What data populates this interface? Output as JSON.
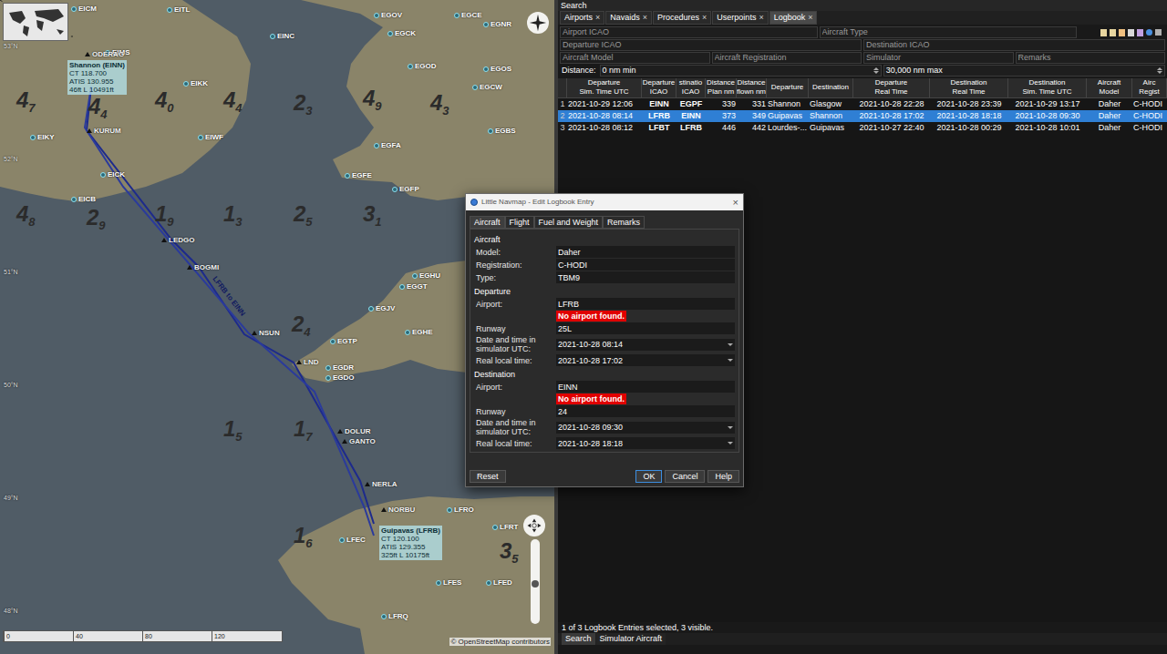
{
  "map": {
    "airports": [
      "EICM",
      "EITL",
      "EGOV",
      "EGCE",
      "EGNR",
      "EINC",
      "EGCK",
      "EGOD",
      "EGOS",
      "EIMS",
      "EIKK",
      "EGCW",
      "EIWF",
      "EIKY",
      "EICK",
      "EICB",
      "EGFA",
      "EGBS",
      "EGFE",
      "EGFP",
      "EGHU",
      "EGGT",
      "EGJV",
      "EGHE",
      "EGTP",
      "EGDR",
      "EGDO",
      "LFRO",
      "LFRT",
      "LFEC",
      "LFES",
      "LFED",
      "LFRQ"
    ],
    "waypoints": [
      "ODERAG",
      "KURUM",
      "LEDGO",
      "BOGMI",
      "NSUN",
      "LND",
      "DOLUR",
      "GANTO",
      "NERLA",
      "NORBU"
    ],
    "airport_boxes": [
      {
        "lines": [
          "Shannon (EINN)",
          "CT 118.700",
          "ATIS 130.955",
          "46ft L 10491ft"
        ]
      },
      {
        "lines": [
          "Guipavas (LFRB)",
          "CT 120.100",
          "ATIS 129.355",
          "325ft L 10175ft"
        ]
      }
    ],
    "grid": [
      {
        "big": "4",
        "small": "7"
      },
      {
        "big": "4",
        "small": "4"
      },
      {
        "big": "4",
        "small": "0"
      },
      {
        "big": "4",
        "small": "4"
      },
      {
        "big": "2",
        "small": "3"
      },
      {
        "big": "4",
        "small": "9"
      },
      {
        "big": "4",
        "small": "3"
      },
      {
        "big": "4",
        "small": "8"
      },
      {
        "big": "2",
        "small": "9"
      },
      {
        "big": "1",
        "small": "9"
      },
      {
        "big": "1",
        "small": "3"
      },
      {
        "big": "2",
        "small": "5"
      },
      {
        "big": "3",
        "small": "1"
      },
      {
        "big": "2",
        "small": "4"
      },
      {
        "big": "1",
        "small": "5"
      },
      {
        "big": "1",
        "small": "7"
      },
      {
        "big": "1",
        "small": "6"
      },
      {
        "big": "3",
        "small": "5"
      }
    ],
    "latitudes": [
      "53°N",
      "52°N",
      "51°N",
      "50°N",
      "49°N",
      "48°N"
    ],
    "route_label": "LFRB to EINN",
    "scale": [
      "0",
      "40",
      "80",
      "120"
    ],
    "attribution": "© OpenStreetMap contributors"
  },
  "search_panel": {
    "title": "Search",
    "tabs": [
      {
        "label": "Airports",
        "close": "×",
        "selected": false
      },
      {
        "label": "Navaids",
        "close": "×",
        "selected": false
      },
      {
        "label": "Procedures",
        "close": "×",
        "selected": false
      },
      {
        "label": "Userpoints",
        "close": "×",
        "selected": false
      },
      {
        "label": "Logbook",
        "close": "×",
        "selected": true
      }
    ],
    "filter_rows": [
      [
        "Airport ICAO",
        "Aircraft Type"
      ],
      [
        "Departure ICAO",
        "Destination ICAO"
      ],
      [
        "Aircraft Model",
        "Aircraft Registration",
        "Simulator",
        "Remarks"
      ]
    ],
    "distance": {
      "label": "Distance:",
      "min": "0 nm min",
      "max": "30,000 nm max"
    },
    "table": {
      "columns": [
        {
          "lines": [
            "Departure",
            "Sim. Time UTC"
          ]
        },
        {
          "lines": [
            "Departure",
            "ICAO"
          ]
        },
        {
          "lines": [
            "stinatio",
            "ICAO"
          ]
        },
        {
          "lines": [
            "Distance",
            "Plan nm"
          ]
        },
        {
          "lines": [
            "Distance",
            "flown nm"
          ]
        },
        {
          "lines": [
            "Departure"
          ]
        },
        {
          "lines": [
            "Destination"
          ]
        },
        {
          "lines": [
            "Departure",
            "Real Time"
          ]
        },
        {
          "lines": [
            "Destination",
            "Real Time"
          ]
        },
        {
          "lines": [
            "Destination",
            "Sim. Time UTC"
          ]
        },
        {
          "lines": [
            "Aircraft",
            "Model"
          ]
        },
        {
          "lines": [
            "Airc",
            "Regist"
          ]
        }
      ],
      "rows": [
        {
          "selected": false,
          "cells": [
            "1",
            "2021-10-29 12:06",
            "EINN",
            "EGPF",
            "339",
            "331",
            "Shannon",
            "Glasgow",
            "2021-10-28 22:28",
            "2021-10-28 23:39",
            "2021-10-29 13:17",
            "Daher",
            "C-HODI"
          ]
        },
        {
          "selected": true,
          "cells": [
            "2",
            "2021-10-28 08:14",
            "LFRB",
            "EINN",
            "373",
            "349",
            "Guipavas",
            "Shannon",
            "2021-10-28 17:02",
            "2021-10-28 18:18",
            "2021-10-28 09:30",
            "Daher",
            "C-HODI"
          ]
        },
        {
          "selected": false,
          "cells": [
            "3",
            "2021-10-28 08:12",
            "LFBT",
            "LFRB",
            "446",
            "442",
            "Lourdes-...",
            "Guipavas",
            "2021-10-27 22:40",
            "2021-10-28 00:29",
            "2021-10-28 10:01",
            "Daher",
            "C-HODI"
          ]
        }
      ]
    },
    "status": "1 of 3 Logbook Entries selected, 3 visible."
  },
  "bottom_tabs": [
    {
      "label": "Search",
      "selected": true
    },
    {
      "label": "Simulator Aircraft",
      "selected": false
    }
  ],
  "dialog": {
    "title": "Little Navmap - Edit Logbook Entry",
    "close": "×",
    "tabs": [
      {
        "label": "Aircraft",
        "selected": true
      },
      {
        "label": "Flight",
        "selected": false
      },
      {
        "label": "Fuel and Weight",
        "selected": false
      },
      {
        "label": "Remarks",
        "selected": false
      }
    ],
    "sections": [
      {
        "heading": "Aircraft",
        "fields": [
          {
            "kind": "text",
            "label": "Model:",
            "value": "Daher"
          },
          {
            "kind": "text",
            "label": "Registration:",
            "value": "C-HODI"
          },
          {
            "kind": "text",
            "label": "Type:",
            "value": "TBM9"
          }
        ]
      },
      {
        "heading": "Departure",
        "fields": [
          {
            "kind": "text",
            "label": "Airport:",
            "value": "LFRB"
          },
          {
            "kind": "error",
            "value": "No airport found."
          },
          {
            "kind": "text",
            "label": "Runway",
            "value": "25L"
          },
          {
            "kind": "datetime",
            "label": "Date and time in simulator UTC:",
            "value": "2021-10-28 08:14"
          },
          {
            "kind": "datetime",
            "label": "Real local time:",
            "value": "2021-10-28 17:02"
          }
        ]
      },
      {
        "heading": "Destination",
        "fields": [
          {
            "kind": "text",
            "label": "Airport:",
            "value": "EINN"
          },
          {
            "kind": "error",
            "value": "No airport found."
          },
          {
            "kind": "text",
            "label": "Runway",
            "value": "24"
          },
          {
            "kind": "datetime",
            "label": "Date and time in simulator UTC:",
            "value": "2021-10-28 09:30"
          },
          {
            "kind": "datetime",
            "label": "Real local time:",
            "value": "2021-10-28 18:18"
          }
        ]
      }
    ],
    "left_buttons": [
      {
        "label": "Reset",
        "default": false
      }
    ],
    "right_buttons": [
      {
        "label": "OK",
        "default": true
      },
      {
        "label": "Cancel",
        "default": false
      },
      {
        "label": "Help",
        "default": false
      }
    ]
  }
}
